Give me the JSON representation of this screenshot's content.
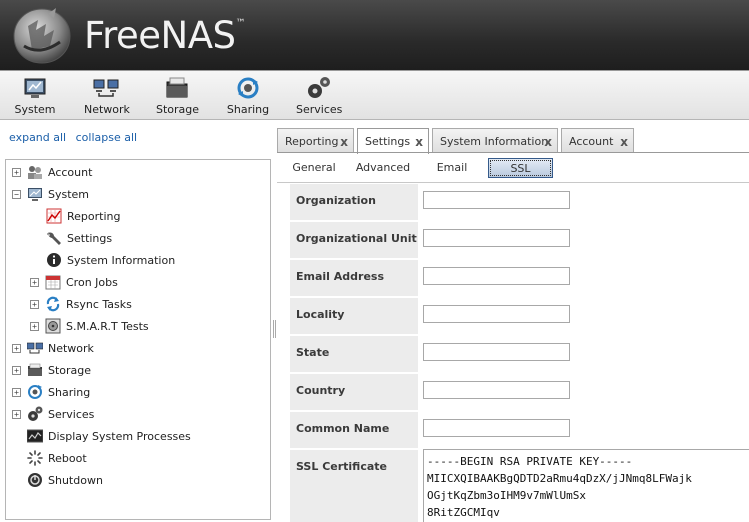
{
  "brand": {
    "name": "FreeNAS",
    "trademark": "™"
  },
  "toolbar": {
    "items": [
      {
        "label": "System",
        "icon": "system-icon"
      },
      {
        "label": "Network",
        "icon": "network-icon"
      },
      {
        "label": "Storage",
        "icon": "storage-icon"
      },
      {
        "label": "Sharing",
        "icon": "sharing-icon"
      },
      {
        "label": "Services",
        "icon": "services-icon"
      }
    ]
  },
  "tree": {
    "expand_all": "expand all",
    "collapse_all": "collapse all",
    "items": [
      {
        "label": "Account",
        "icon": "account-icon",
        "expander": "+"
      },
      {
        "label": "System",
        "icon": "system-icon",
        "expander": "−"
      },
      {
        "label": "Reporting",
        "icon": "reporting-icon"
      },
      {
        "label": "Settings",
        "icon": "wrench-icon"
      },
      {
        "label": "System Information",
        "icon": "info-icon"
      },
      {
        "label": "Cron Jobs",
        "icon": "calendar-icon",
        "expander": "+"
      },
      {
        "label": "Rsync Tasks",
        "icon": "sync-icon",
        "expander": "+"
      },
      {
        "label": "S.M.A.R.T Tests",
        "icon": "disk-test-icon",
        "expander": "+"
      },
      {
        "label": "Network",
        "icon": "network-icon",
        "expander": "+"
      },
      {
        "label": "Storage",
        "icon": "storage-icon",
        "expander": "+"
      },
      {
        "label": "Sharing",
        "icon": "sharing-icon",
        "expander": "+"
      },
      {
        "label": "Services",
        "icon": "services-icon",
        "expander": "+"
      },
      {
        "label": "Display System Processes",
        "icon": "processes-icon"
      },
      {
        "label": "Reboot",
        "icon": "reboot-icon"
      },
      {
        "label": "Shutdown",
        "icon": "shutdown-icon"
      }
    ]
  },
  "tabs": [
    {
      "label": "Reporting",
      "close": "x"
    },
    {
      "label": "Settings",
      "close": "x"
    },
    {
      "label": "System Information",
      "close": "x"
    },
    {
      "label": "Account",
      "close": "x"
    }
  ],
  "subtabs": [
    {
      "label": "General"
    },
    {
      "label": "Advanced"
    },
    {
      "label": "Email"
    },
    {
      "label": "SSL"
    }
  ],
  "form": {
    "fields": [
      {
        "label": "Organization",
        "value": ""
      },
      {
        "label": "Organizational Unit",
        "value": ""
      },
      {
        "label": "Email Address",
        "value": ""
      },
      {
        "label": "Locality",
        "value": ""
      },
      {
        "label": "State",
        "value": ""
      },
      {
        "label": "Country",
        "value": ""
      },
      {
        "label": "Common Name",
        "value": ""
      }
    ],
    "certificate": {
      "label": "SSL Certificate",
      "value": "-----BEGIN RSA PRIVATE KEY-----\nMIICXQIBAAKBgQDTD2aRmu4qDzX/jJNmq8LFWajk\nOGjtKqZbm3oIHM9v7mWlUmSx\n8RitZGCMIqv"
    }
  },
  "colors": {
    "header_bg": "#2a2a2a",
    "link": "#1a5ea8",
    "active_subtab": "#b9c9de"
  }
}
